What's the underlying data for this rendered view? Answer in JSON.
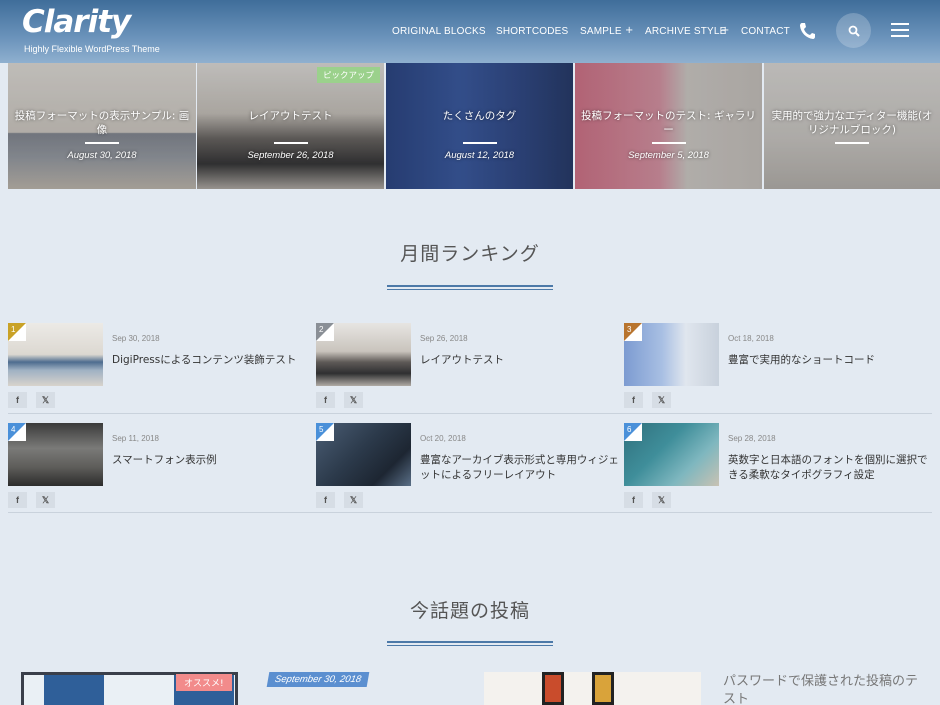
{
  "header": {
    "logo": "Clarity",
    "tagline": "Highly Flexible WordPress Theme",
    "nav": [
      "ORIGINAL BLOCKS",
      "SHORTCODES",
      "SAMPLE",
      "ARCHIVE STYLE",
      "CONTACT"
    ],
    "icons": [
      "phone-icon",
      "search-icon",
      "menu-icon"
    ]
  },
  "slider": [
    {
      "title": "投稿フォーマットの表示サンプル: 画像",
      "date": "August 30, 2018",
      "badge": ""
    },
    {
      "title": "レイアウトテスト",
      "date": "September 26, 2018",
      "badge": "ピックアップ"
    },
    {
      "title": "たくさんのタグ",
      "date": "August 12, 2018",
      "badge": ""
    },
    {
      "title": "投稿フォーマットのテスト: ギャラリー",
      "date": "September 5, 2018",
      "badge": ""
    },
    {
      "title": "実用的で強力なエディター機能(オリジナルブロック)",
      "date": "",
      "badge": ""
    }
  ],
  "ranking": {
    "title": "月間ランキング",
    "items": [
      {
        "rank": "1",
        "date": "Sep 30, 2018",
        "title": "DigiPressによるコンテンツ装飾テスト",
        "color": "#c9a227"
      },
      {
        "rank": "2",
        "date": "Sep 26, 2018",
        "title": "レイアウトテスト",
        "color": "#8a8f96"
      },
      {
        "rank": "3",
        "date": "Oct 18, 2018",
        "title": "豊富で実用的なショートコード",
        "color": "#b8742e"
      },
      {
        "rank": "4",
        "date": "Sep 11, 2018",
        "title": "スマートフォン表示例",
        "color": "#4a90d9"
      },
      {
        "rank": "5",
        "date": "Oct 20, 2018",
        "title": "豊富なアーカイブ表示形式と専用ウィジェットによるフリーレイアウト",
        "color": "#4a90d9"
      },
      {
        "rank": "6",
        "date": "Sep 28, 2018",
        "title": "英数字と日本語のフォントを個別に選択できる柔軟なタイポグラフィ設定",
        "color": "#4a90d9"
      }
    ],
    "share": [
      "f",
      "𝕏"
    ]
  },
  "trending": {
    "title": "今話題の投稿",
    "badge": "オススメ!",
    "date": "September 30, 2018",
    "post2_title": "パスワードで保護された投稿のテスト"
  }
}
